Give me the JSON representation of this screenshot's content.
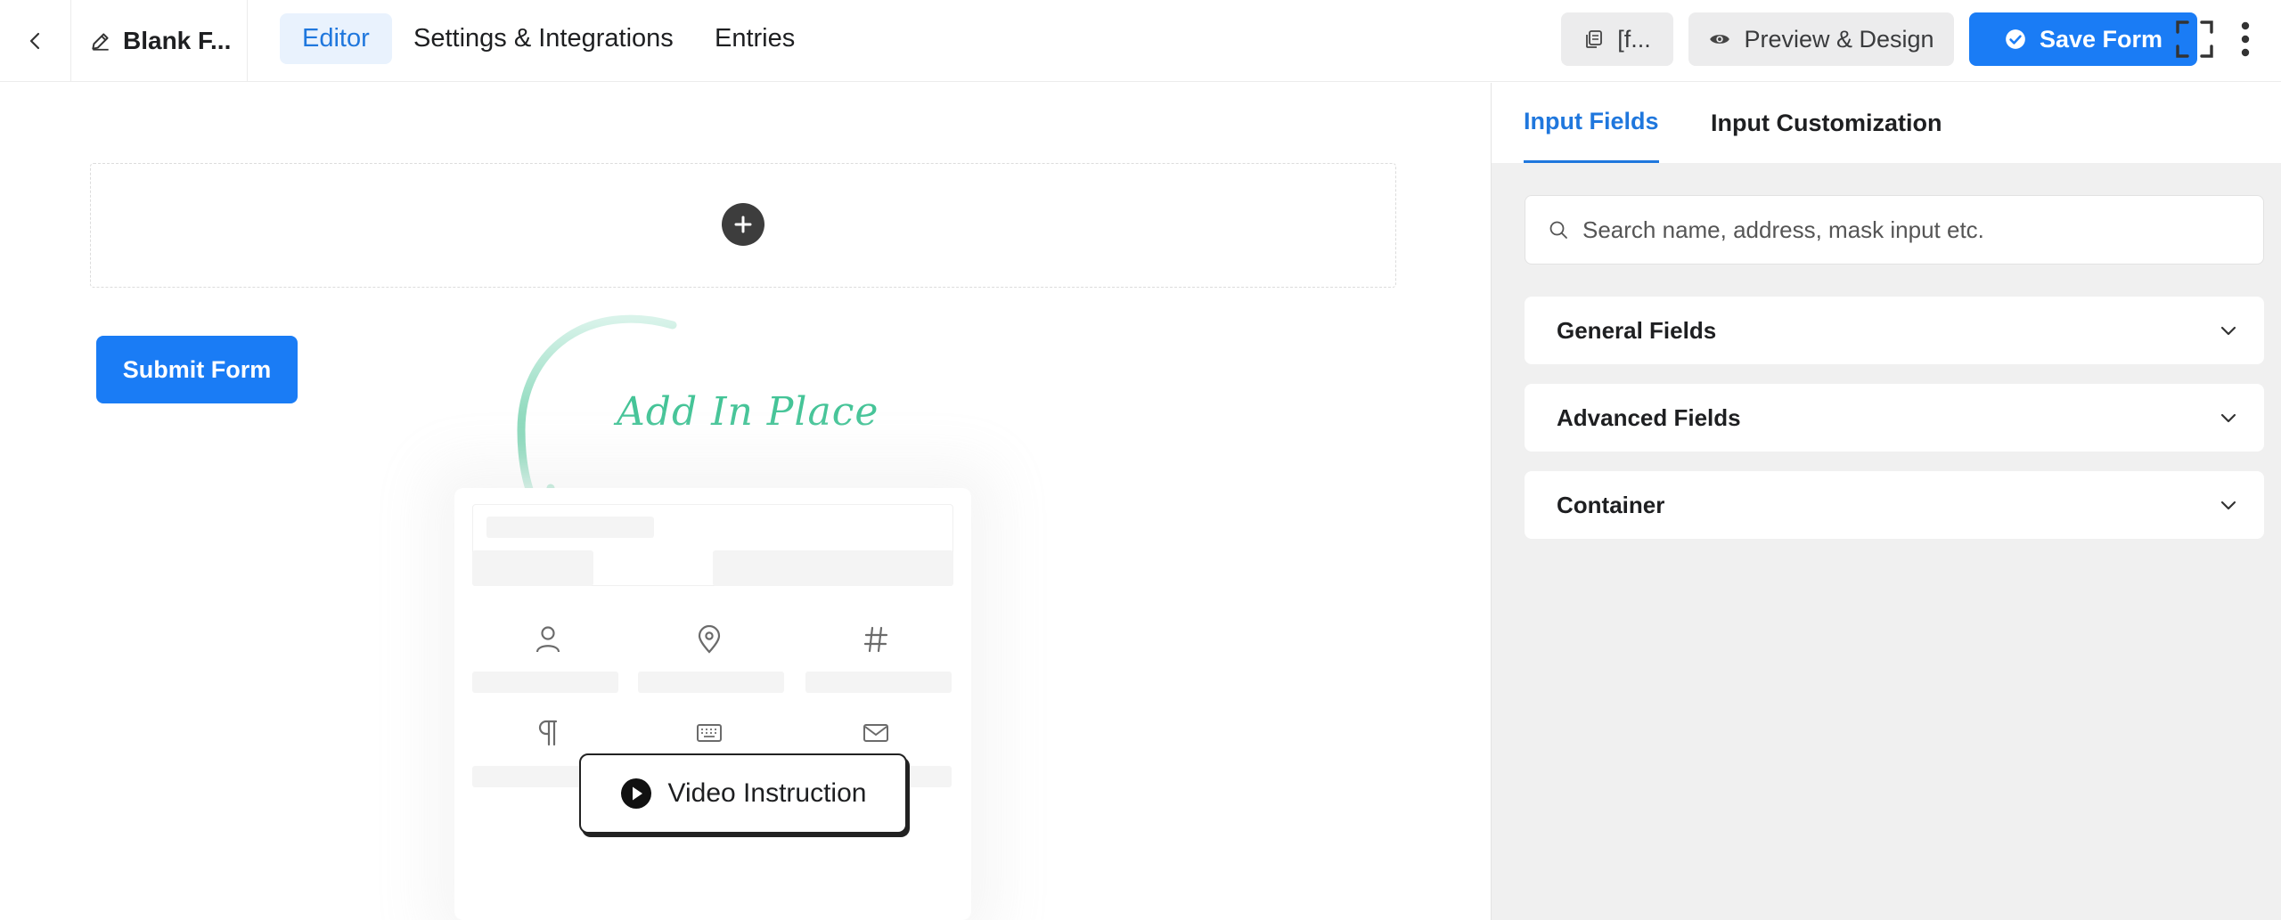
{
  "header": {
    "form_title": "Blank F...",
    "tabs": [
      {
        "label": "Editor",
        "active": true
      },
      {
        "label": "Settings & Integrations",
        "active": false
      },
      {
        "label": "Entries",
        "active": false
      }
    ],
    "shortcode_label": "[f...",
    "preview_label": "Preview & Design",
    "save_label": "Save Form"
  },
  "editor": {
    "submit_label": "Submit Form",
    "hint_text": "Add In Place",
    "video_label": "Video Instruction"
  },
  "sidebar": {
    "tabs": [
      {
        "label": "Input Fields",
        "active": true
      },
      {
        "label": "Input Customization",
        "active": false
      }
    ],
    "search_placeholder": "Search name, address, mask input etc.",
    "sections": [
      {
        "label": "General Fields"
      },
      {
        "label": "Advanced Fields"
      },
      {
        "label": "Container"
      }
    ]
  },
  "colors": {
    "accent": "#1a7cf5",
    "tab_active_bg": "#e9f2fd",
    "hint_green": "#44c497"
  }
}
